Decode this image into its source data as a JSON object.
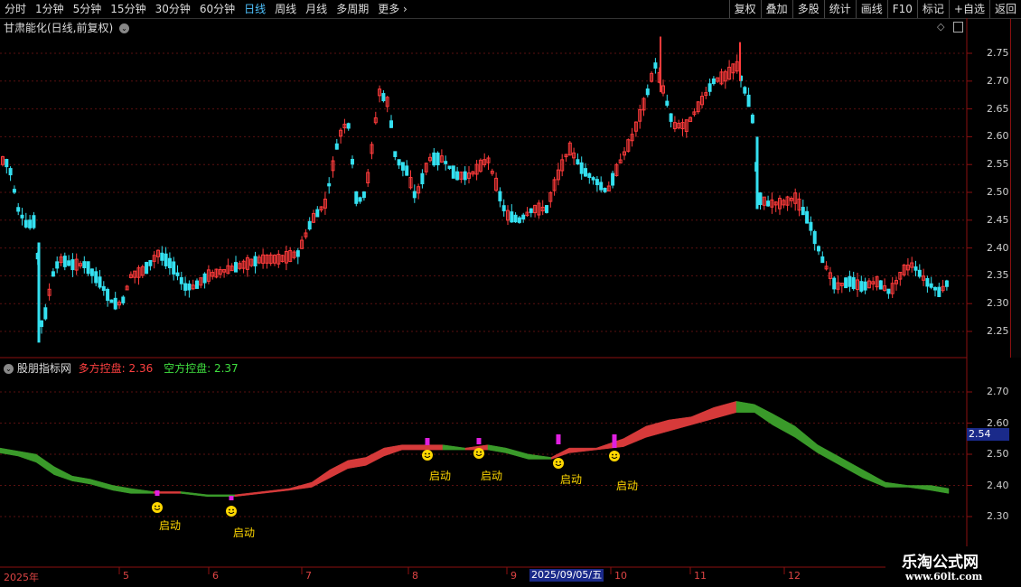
{
  "toolbar": {
    "periods": [
      "分时",
      "1分钟",
      "5分钟",
      "15分钟",
      "30分钟",
      "60分钟",
      "日线",
      "周线",
      "月线",
      "多周期",
      "更多 ›"
    ],
    "active_period": "日线",
    "actions": [
      "复权",
      "叠加",
      "多股",
      "统计",
      "画线",
      "F10",
      "标记",
      "+自选",
      "返回"
    ]
  },
  "stock_title": "甘肃能化(日线,前复权)",
  "indicator": {
    "name": "股朋指标网",
    "long_label": "多方控盘:",
    "long_value": "2.36",
    "short_label": "空方控盘:",
    "short_value": "2.37",
    "signal_label": "启动"
  },
  "price_axis": [
    "2.75",
    "2.70",
    "2.65",
    "2.60",
    "2.55",
    "2.50",
    "2.45",
    "2.40",
    "2.35",
    "2.30",
    "2.25"
  ],
  "ind_axis": [
    "2.70",
    "2.60",
    "2.50",
    "2.40",
    "2.30"
  ],
  "ind_current": "2.54",
  "date_axis": {
    "year": "2025年",
    "months": [
      "5",
      "6",
      "7",
      "8",
      "9",
      "10",
      "11",
      "12"
    ],
    "cursor_date": "2025/09/05/五"
  },
  "watermark": {
    "title": "乐淘公式网",
    "url": "www.60lt.com"
  },
  "colors": {
    "up": "#ff3b3b",
    "down": "#34e0f0",
    "bull_band": "#d63a3a",
    "bear_band": "#3a9a2a",
    "signal_bar": "#e020e0",
    "smile": "#ffd700",
    "axis_frame": "#8b1010"
  }
}
